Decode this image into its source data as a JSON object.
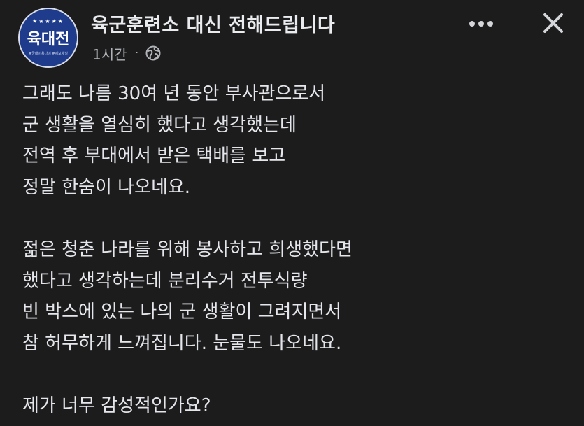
{
  "post": {
    "avatar": {
      "stars": "★★★★★",
      "title": "육대전",
      "subtitle": "#군대이용나이 #제보채널"
    },
    "page_name": "육군훈련소 대신 전해드립니다",
    "timestamp": "1시간",
    "separator": "·",
    "privacy_icon": "globe-icon",
    "more_icon": "more-horizontal-icon",
    "close_icon": "close-icon",
    "paragraphs": [
      {
        "lines": [
          "그래도 나름 30여 년 동안 부사관으로서",
          "군 생활을 열심히 했다고 생각했는데",
          "전역 후 부대에서 받은 택배를 보고",
          "정말 한숨이 나오네요."
        ]
      },
      {
        "lines": [
          "젊은 청춘 나라를 위해 봉사하고 희생했다면",
          "했다고 생각하는데 분리수거 전투식량",
          "빈 박스에 있는 나의 군 생활이 그려지면서",
          "참 허무하게 느껴집니다. 눈물도 나오네요."
        ]
      },
      {
        "lines": [
          "제가 너무 감성적인가요?"
        ]
      }
    ]
  },
  "colors": {
    "background": "#1c1c1d",
    "text": "#e4e6eb",
    "secondary_text": "#b0b3b8",
    "avatar_bg": "#1f3c8c"
  }
}
